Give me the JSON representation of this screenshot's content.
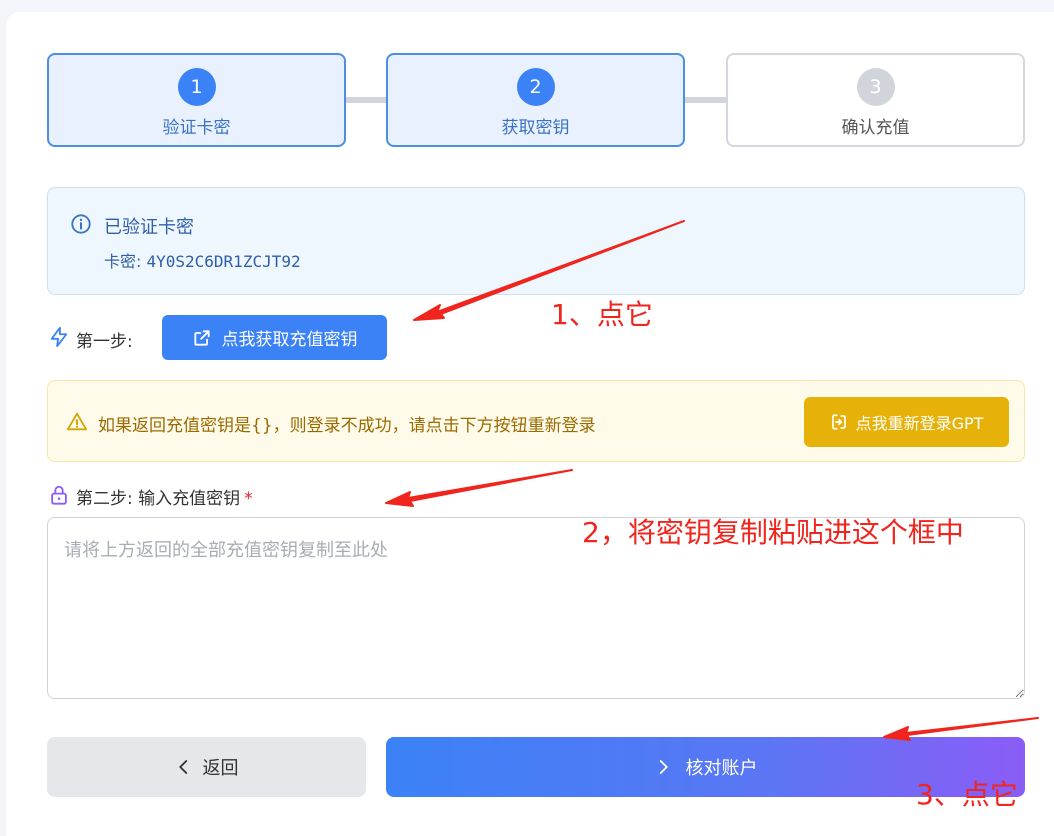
{
  "stepper": {
    "steps": [
      {
        "num": "1",
        "label": "验证卡密",
        "state": "done"
      },
      {
        "num": "2",
        "label": "获取密钥",
        "state": "active"
      },
      {
        "num": "3",
        "label": "确认充值",
        "state": "pending"
      }
    ]
  },
  "info": {
    "title": "已验证卡密",
    "code_label": "卡密: ",
    "code_value": "4Y0S2C6DR1ZCJT92"
  },
  "step1": {
    "label": "第一步:",
    "button_label": "点我获取充值密钥"
  },
  "warning": {
    "text": "如果返回充值密钥是{}，则登录不成功，请点击下方按钮重新登录",
    "button_label": "点我重新登录GPT"
  },
  "step2": {
    "label": "第二步: 输入充值密钥",
    "required_mark": "*",
    "placeholder": "请将上方返回的全部充值密钥复制至此处"
  },
  "footer": {
    "back_label": "返回",
    "verify_label": "核对账户"
  },
  "annotations": {
    "a1": "1、点它",
    "a2": "2，将密钥复制粘贴进这个框中",
    "a3": "3、点它"
  },
  "colors": {
    "primary": "#3b82f6",
    "warning_button": "#e6b20a",
    "annotation": "#f0251e",
    "gradient_end": "#8b5cf6"
  }
}
